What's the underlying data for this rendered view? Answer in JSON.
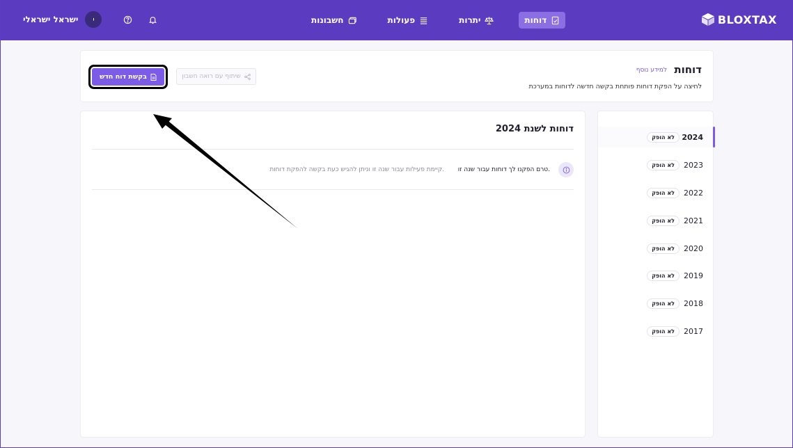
{
  "brand": {
    "name": "BLOXTAX"
  },
  "nav": {
    "items": [
      {
        "label": "חשבונות",
        "icon": "wallet-icon",
        "active": false
      },
      {
        "label": "פעולות",
        "icon": "list-icon",
        "active": false
      },
      {
        "label": "יתרות",
        "icon": "balance-scale-icon",
        "active": false
      },
      {
        "label": "דוחות",
        "icon": "report-icon",
        "active": true
      }
    ]
  },
  "user": {
    "name": "ישראל ישראלי",
    "initial": "י"
  },
  "header": {
    "title": "דוחות",
    "more_info": "למידע נוסף",
    "subtitle": "לחיצה על הפקת דוחות פותחת בקשה חדשה לדוחות במערכת",
    "new_report_label": "בקשת דוח חדש",
    "share_label": "שיתוף עם רואה חשבון"
  },
  "years": [
    {
      "year": "2024",
      "status": "לא הופק",
      "active": true
    },
    {
      "year": "2023",
      "status": "לא הופק",
      "active": false
    },
    {
      "year": "2022",
      "status": "לא הופק",
      "active": false
    },
    {
      "year": "2021",
      "status": "לא הופק",
      "active": false
    },
    {
      "year": "2020",
      "status": "לא הופק",
      "active": false
    },
    {
      "year": "2019",
      "status": "לא הופק",
      "active": false
    },
    {
      "year": "2018",
      "status": "לא הופק",
      "active": false
    },
    {
      "year": "2017",
      "status": "לא הופק",
      "active": false
    }
  ],
  "content": {
    "title": "דוחות לשנת 2024",
    "info_main": "טרם הפקנו לך דוחות עבור שנה זו.",
    "info_sub": "קיימת פעילות עבור שנה זו וניתן להגיש כעת בקשה להפקת דוחות."
  },
  "colors": {
    "topbar": "#5b3bbf",
    "accent": "#7c5ce6",
    "active_nav": "#8b6ee3"
  }
}
